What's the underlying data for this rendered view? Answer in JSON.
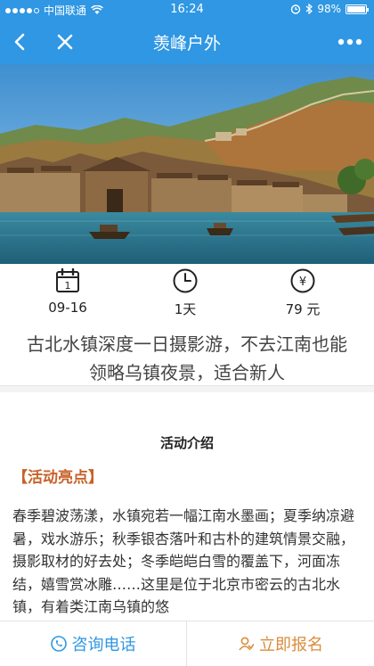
{
  "status_bar": {
    "carrier": "中国联通",
    "time": "16:24",
    "battery": "98%",
    "battery_level": 0.98
  },
  "nav": {
    "title": "羡峰户外",
    "back_icon": "chevron-left-icon",
    "close_icon": "close-icon",
    "more_icon": "more-dots-icon"
  },
  "info": {
    "date": "09-16",
    "duration": "1天",
    "price": "79 元",
    "calendar_day": "1",
    "price_symbol": "¥"
  },
  "activity": {
    "title": "古北水镇深度一日摄影游，不去江南也能领略乌镇夜景，适合新人",
    "section_title": "活动介绍",
    "highlight_label": "【活动亮点】",
    "description": "春季碧波荡漾，水镇宛若一幅江南水墨画；夏季纳凉避暑，戏水游乐；秋季银杏落叶和古朴的建筑情景交融，摄影取材的好去处；冬季皑皑白雪的覆盖下，河面冻结，嬉雪赏冰雕……这里是位于北京市密云的古北水镇，有着类江南乌镇的悠"
  },
  "bottom": {
    "consult_label": "咨询电话",
    "signup_label": "立即报名"
  },
  "colors": {
    "primary": "#2f97e3",
    "accent": "#d98d3c",
    "highlight": "#c8622a"
  }
}
